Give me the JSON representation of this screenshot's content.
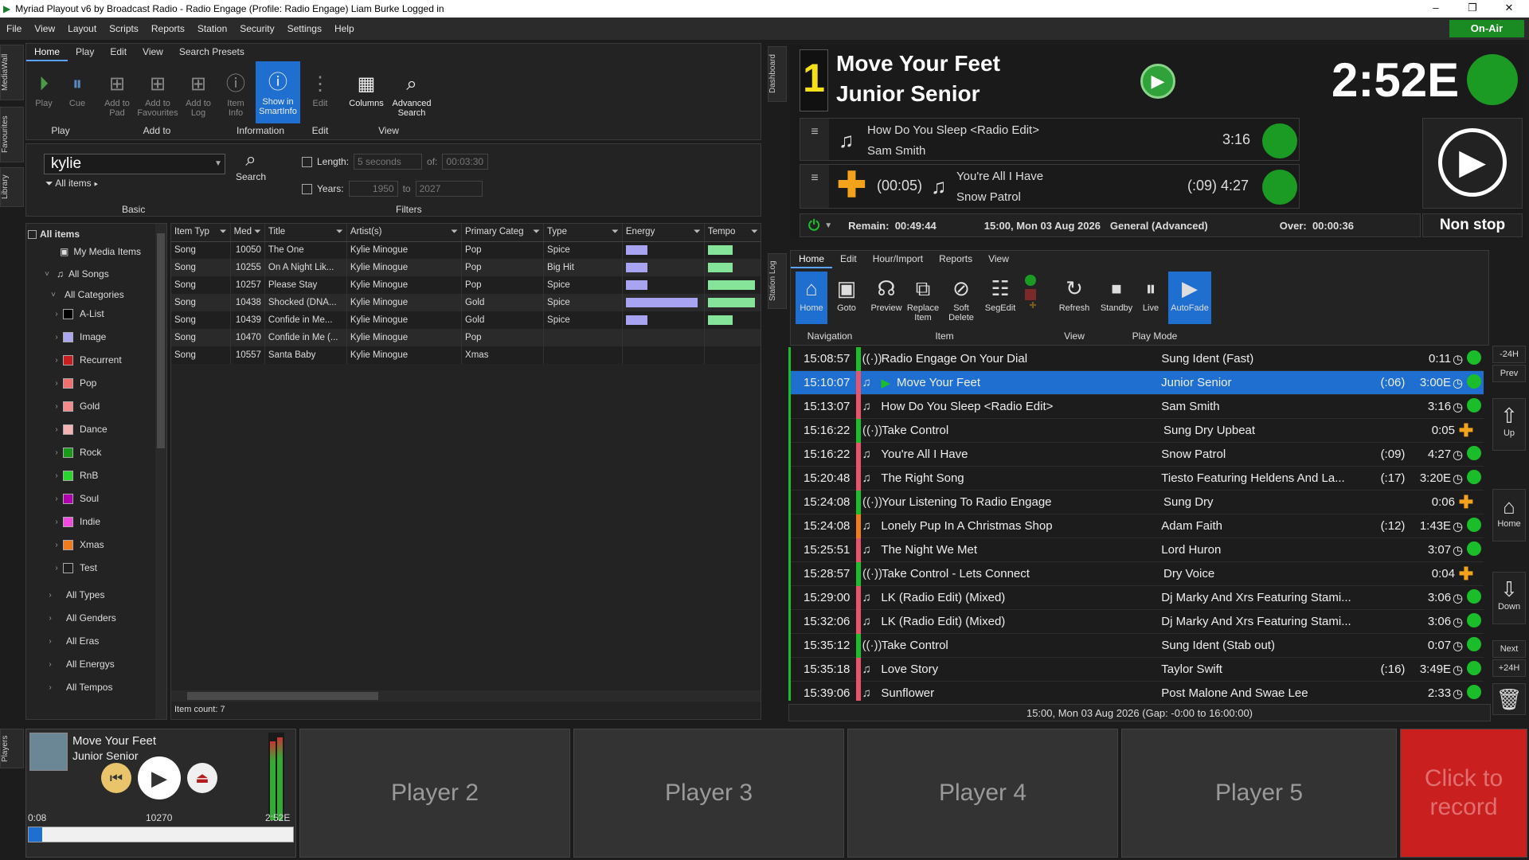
{
  "window": {
    "title": "Myriad Playout v6 by Broadcast Radio - Radio Engage (Profile: Radio Engage) Liam Burke Logged in"
  },
  "menu": [
    "File",
    "View",
    "Layout",
    "Scripts",
    "Reports",
    "Station",
    "Security",
    "Settings",
    "Help"
  ],
  "onair": "On-Air",
  "sidetabs": {
    "mediawall": "MediaWall",
    "favourites": "Favourites",
    "library": "Library",
    "dashboard": "Dashboard",
    "stationlog": "Station Log",
    "players": "Players"
  },
  "library": {
    "ribbon_tabs": [
      "Home",
      "Play",
      "Edit",
      "View",
      "Search Presets"
    ],
    "buttons": {
      "play": "Play",
      "cue": "Cue",
      "add_pad": "Add to Pad",
      "add_fav": "Add to Favourites",
      "add_log": "Add to Log",
      "item_info": "Item Info",
      "smartinfo": "Show in SmartInfo",
      "edit": "Edit",
      "columns": "Columns",
      "adv_search": "Advanced Search"
    },
    "groups": {
      "play": "Play",
      "addto": "Add to",
      "info": "Information",
      "edit": "Edit",
      "view": "View"
    },
    "search": {
      "value": "kylie",
      "all_items": "All items",
      "search_btn": "Search",
      "basic": "Basic"
    },
    "filters": {
      "length": "Length:",
      "length_val": "5 seconds",
      "of": "of:",
      "of_val": "00:03:30",
      "years": "Years:",
      "from": "1950",
      "to": "to",
      "to_val": "2027",
      "label": "Filters"
    },
    "tree": {
      "all_items": "All items",
      "my_media": "My Media Items",
      "all_songs": "All Songs",
      "all_categories": "All Categories",
      "categories": [
        {
          "name": "A-List",
          "color": "#000000"
        },
        {
          "name": "Image",
          "color": "#aaa6f0"
        },
        {
          "name": "Recurrent",
          "color": "#c81e1e"
        },
        {
          "name": "Pop",
          "color": "#f26f6f"
        },
        {
          "name": "Gold",
          "color": "#f58a8a"
        },
        {
          "name": "Dance",
          "color": "#f6b3b3"
        },
        {
          "name": "Rock",
          "color": "#1a9a1a"
        },
        {
          "name": "RnB",
          "color": "#2bd62b"
        },
        {
          "name": "Soul",
          "color": "#b000b0"
        },
        {
          "name": "Indie",
          "color": "#f24ae0"
        },
        {
          "name": "Xmas",
          "color": "#f27b1a"
        },
        {
          "name": "Test",
          "color": "#1f1f1f"
        }
      ],
      "more": [
        "All Types",
        "All Genders",
        "All Eras",
        "All Energys",
        "All Tempos"
      ]
    },
    "columns": [
      "Item Typ",
      "Med",
      "Title",
      "Artist(s)",
      "Primary Categ",
      "Type",
      "Energy",
      "Tempo"
    ],
    "rows": [
      {
        "type": "Song",
        "med": "10050",
        "title": "The One",
        "artist": "Kylie Minogue",
        "cat": "Pop",
        "ctype": "Spice",
        "energy": 0.3,
        "tempo": 0.5
      },
      {
        "type": "Song",
        "med": "10255",
        "title": "On A Night Lik...",
        "artist": "Kylie Minogue",
        "cat": "Pop",
        "ctype": "Big Hit",
        "energy": 0.3,
        "tempo": 0.5
      },
      {
        "type": "Song",
        "med": "10257",
        "title": "Please Stay",
        "artist": "Kylie Minogue",
        "cat": "Pop",
        "ctype": "Spice",
        "energy": 0.3,
        "tempo": 0.95
      },
      {
        "type": "Song",
        "med": "10438",
        "title": "Shocked (DNA...",
        "artist": "Kylie Minogue",
        "cat": "Gold",
        "ctype": "Spice",
        "energy": 1.0,
        "tempo": 0.95
      },
      {
        "type": "Song",
        "med": "10439",
        "title": "Confide in Me...",
        "artist": "Kylie Minogue",
        "cat": "Gold",
        "ctype": "Spice",
        "energy": 0.3,
        "tempo": 0.5
      },
      {
        "type": "Song",
        "med": "10470",
        "title": "Confide in Me (...",
        "artist": "Kylie Minogue",
        "cat": "Pop",
        "ctype": "",
        "energy": 0,
        "tempo": 0
      },
      {
        "type": "Song",
        "med": "10557",
        "title": "Santa Baby",
        "artist": "Kylie Minogue",
        "cat": "Xmas",
        "ctype": "",
        "energy": 0,
        "tempo": 0
      }
    ],
    "item_count": "Item count: 7"
  },
  "dashboard": {
    "num": "1",
    "title": "Move Your Feet",
    "artist": "Junior Senior",
    "time": "2:52E",
    "next1": {
      "title": "How Do You Sleep <Radio Edit>",
      "artist": "Sam Smith",
      "dur": "3:16"
    },
    "next2": {
      "intro": "(00:05)",
      "title": "You're All I Have",
      "artist": "Snow Patrol",
      "dur": "(:09) 4:27"
    },
    "remain_label": "Remain:",
    "remain": "00:49:44",
    "hour": "15:00, Mon 03 Aug 2026",
    "mode": "General (Advanced)",
    "over_label": "Over:",
    "over": "00:00:36",
    "nonstop": "Non stop"
  },
  "log": {
    "ribbon_tabs": [
      "Home",
      "Edit",
      "Hour/Import",
      "Reports",
      "View"
    ],
    "buttons": {
      "home": "Home",
      "goto": "Goto",
      "preview": "Preview",
      "replace": "Replace Item",
      "softdelete": "Soft Delete",
      "segedit": "SegEdit",
      "refresh": "Refresh",
      "standby": "Standby",
      "live": "Live",
      "autofade": "AutoFade"
    },
    "groups": {
      "nav": "Navigation",
      "item": "Item",
      "view": "View",
      "playmode": "Play Mode"
    },
    "rows": [
      {
        "time": "15:08:57",
        "kind": "ident",
        "title": "Radio Engage On Your Dial",
        "artist": "Sung Ident (Fast)",
        "intro": "",
        "dur": "0:11",
        "end": "dot",
        "bar": "#1bbd2a"
      },
      {
        "time": "15:10:07",
        "kind": "song",
        "title": "Move Your Feet",
        "artist": "Junior Senior",
        "intro": "(:06)",
        "dur": "3:00E",
        "end": "dot",
        "bar": "#e8546b",
        "sel": true
      },
      {
        "time": "15:13:07",
        "kind": "song",
        "title": "How Do You Sleep <Radio Edit>",
        "artist": "Sam Smith",
        "intro": "",
        "dur": "3:16",
        "end": "dot",
        "bar": "#e8546b"
      },
      {
        "time": "15:16:22",
        "kind": "ident",
        "title": "Take Control",
        "artist": "Sung Dry Upbeat",
        "intro": "",
        "dur": "0:05",
        "end": "plus",
        "bar": "#1bbd2a"
      },
      {
        "time": "15:16:22",
        "kind": "song",
        "title": "You're All I Have",
        "artist": "Snow Patrol",
        "intro": "(:09)",
        "dur": "4:27",
        "end": "dot",
        "bar": "#e8546b"
      },
      {
        "time": "15:20:48",
        "kind": "song",
        "title": "The Right Song",
        "artist": "Tiesto Featuring Heldens And La...",
        "intro": "(:17)",
        "dur": "3:20E",
        "end": "dot",
        "bar": "#e8546b"
      },
      {
        "time": "15:24:08",
        "kind": "ident",
        "title": "Your Listening To Radio Engage",
        "artist": "Sung Dry",
        "intro": "",
        "dur": "0:06",
        "end": "plus",
        "bar": "#1bbd2a"
      },
      {
        "time": "15:24:08",
        "kind": "song",
        "title": "Lonely Pup In A Christmas Shop",
        "artist": "Adam Faith",
        "intro": "(:12)",
        "dur": "1:43E",
        "end": "dot",
        "bar": "#f27b1a"
      },
      {
        "time": "15:25:51",
        "kind": "song",
        "title": "The Night We Met",
        "artist": "Lord Huron",
        "intro": "",
        "dur": "3:07",
        "end": "dot",
        "bar": "#e8546b"
      },
      {
        "time": "15:28:57",
        "kind": "ident",
        "title": "Take Control - Lets Connect",
        "artist": "Dry Voice",
        "intro": "",
        "dur": "0:04",
        "end": "plus",
        "bar": "#1bbd2a"
      },
      {
        "time": "15:29:00",
        "kind": "song",
        "title": "LK (Radio Edit) (Mixed)",
        "artist": "Dj Marky And Xrs Featuring Stami...",
        "intro": "",
        "dur": "3:06",
        "end": "dot",
        "bar": "#e8546b"
      },
      {
        "time": "15:32:06",
        "kind": "song",
        "title": "LK (Radio Edit) (Mixed)",
        "artist": "Dj Marky And Xrs Featuring Stami...",
        "intro": "",
        "dur": "3:06",
        "end": "dot",
        "bar": "#e8546b"
      },
      {
        "time": "15:35:12",
        "kind": "ident",
        "title": "Take Control",
        "artist": "Sung Ident (Stab out)",
        "intro": "",
        "dur": "0:07",
        "end": "dot",
        "bar": "#1bbd2a"
      },
      {
        "time": "15:35:18",
        "kind": "song",
        "title": "Love Story",
        "artist": "Taylor Swift",
        "intro": "(:16)",
        "dur": "3:49E",
        "end": "dot",
        "bar": "#e8546b"
      },
      {
        "time": "15:39:06",
        "kind": "song",
        "title": "Sunflower",
        "artist": "Post Malone And Swae Lee",
        "intro": "",
        "dur": "2:33",
        "end": "dot",
        "bar": "#e8546b"
      }
    ],
    "footer": "15:00, Mon 03 Aug 2026 (Gap: -0:00 to 16:00:00)",
    "side": {
      "minus24": "-24H",
      "prev": "Prev",
      "up": "Up",
      "home": "Home",
      "down": "Down",
      "next": "Next",
      "plus24": "+24H"
    }
  },
  "player1": {
    "title": "Move Your Feet",
    "artist": "Junior Senior",
    "elapsed": "0:08",
    "id": "10270",
    "remain": "2:52E",
    "progress": 0.05
  },
  "players": [
    "Player 2",
    "Player 3",
    "Player 4",
    "Player 5"
  ],
  "record": "Click to record"
}
